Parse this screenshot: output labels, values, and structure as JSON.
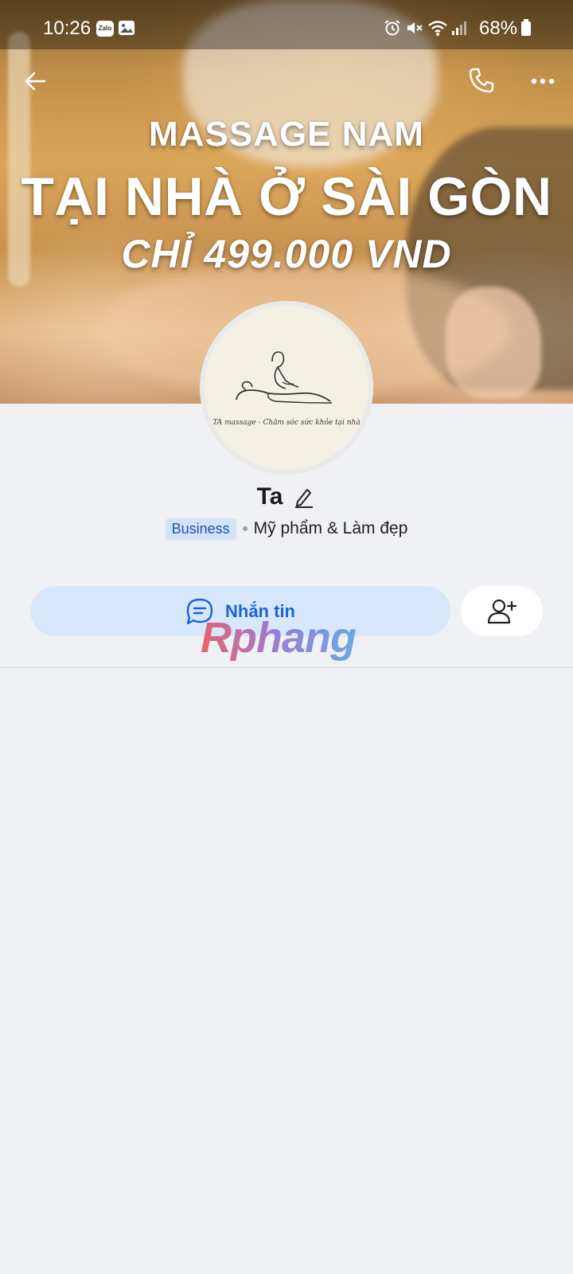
{
  "status_bar": {
    "time": "10:26",
    "zalo_badge": "Zalo",
    "battery_percent": "68%",
    "icons": [
      "zalo-icon",
      "image-icon",
      "alarm-icon",
      "mute-icon",
      "wifi-icon",
      "signal-icon",
      "battery-icon"
    ]
  },
  "cover": {
    "line1": "MASSAGE NAM",
    "line2": "TẠI NHÀ Ở SÀI GÒN",
    "line3": "CHỈ 499.000 VND"
  },
  "avatar": {
    "caption": "TA massage - Chăm sóc sức khỏe tại nhà"
  },
  "profile": {
    "name": "Ta",
    "badge": "Business",
    "category": "Mỹ phẩm & Làm đẹp"
  },
  "actions": {
    "message_label": "Nhắn tin"
  },
  "watermark": "Rphang",
  "colors": {
    "accent": "#1a63de",
    "message_button_bg": "#d8e8fc",
    "badge_bg": "#d2e3fb",
    "page_bg": "#f0f1f5"
  }
}
